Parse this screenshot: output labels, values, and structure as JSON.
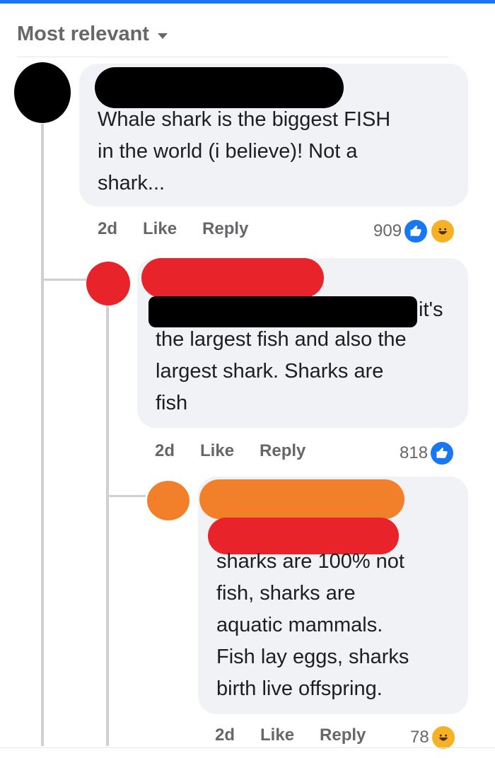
{
  "sort": {
    "label": "Most relevant"
  },
  "comments": [
    {
      "text": "Whale shark is the biggest FISH\nin the world (i believe)! Not a\nshark...",
      "time": "2d",
      "like_label": "Like",
      "reply_label": "Reply",
      "reaction_count": "909",
      "reactions": [
        "like-icon",
        "haha-icon"
      ],
      "redaction_color": "#000000"
    },
    {
      "text_lead": "it's",
      "text": "the largest fish and also the\nlargest shark. Sharks are\nfish",
      "time": "2d",
      "like_label": "Like",
      "reply_label": "Reply",
      "reaction_count": "818",
      "reactions": [
        "like-icon"
      ],
      "redaction_color": "#e8232a"
    },
    {
      "text": "sharks are 100% not\nfish, sharks are\naquatic mammals.\nFish lay eggs, sharks\nbirth live offspring.",
      "time": "2d",
      "like_label": "Like",
      "reply_label": "Reply",
      "reaction_count": "78",
      "reactions": [
        "haha-icon"
      ],
      "redaction_color": "#f2802a"
    }
  ],
  "colors": {
    "accent": "#1877f2",
    "bubble": "#f0f2f5",
    "meta_text": "#65676b",
    "haha": "#f7b125"
  }
}
